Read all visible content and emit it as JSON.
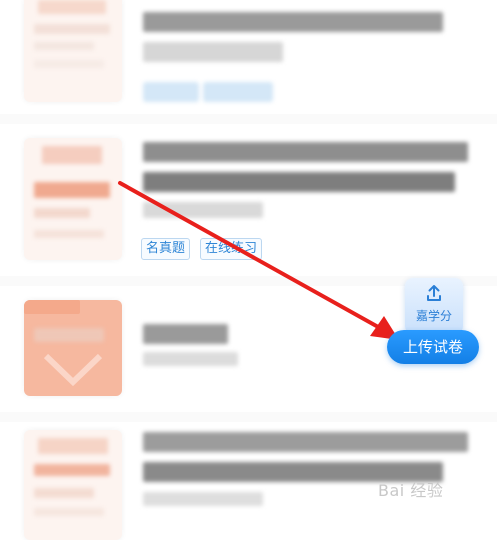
{
  "items": [
    {
      "tags": []
    },
    {
      "tags": [
        "名真题",
        "在线练习"
      ]
    },
    {
      "tags": []
    },
    {
      "tags": []
    }
  ],
  "float_button": {
    "brand_label": "嘉学分",
    "action_label": "上传试卷",
    "icon": "upload-icon"
  },
  "annotation": {
    "color": "#e8201c"
  },
  "watermark": {
    "text": "Bai 经验"
  }
}
